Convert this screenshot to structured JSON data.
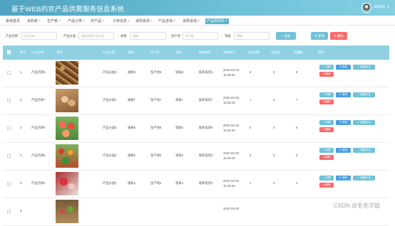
{
  "header": {
    "app_title": "基于WEB的农产品供需服务信息系统",
    "user_name": "admin",
    "user_caret": "▾"
  },
  "tabs": [
    {
      "label": "系统首页",
      "closable": false,
      "active": false
    },
    {
      "label": "采购者",
      "closable": true,
      "active": false
    },
    {
      "label": "生产者",
      "closable": true,
      "active": false
    },
    {
      "label": "产品分类",
      "closable": true,
      "active": false
    },
    {
      "label": "农产品",
      "closable": true,
      "active": false
    },
    {
      "label": "订单信息",
      "closable": true,
      "active": false
    },
    {
      "label": "采购需求",
      "closable": true,
      "active": false
    },
    {
      "label": "产品咨询",
      "closable": true,
      "active": false
    },
    {
      "label": "采购咨询",
      "closable": true,
      "active": false
    },
    {
      "label": "产品预评价",
      "closable": true,
      "active": true
    }
  ],
  "tab_close_glyph": "×",
  "search": {
    "fields": [
      {
        "label": "产品名称",
        "placeholder": "产品名称"
      },
      {
        "label": "产品分类",
        "placeholder": "请到选择产品分类"
      },
      {
        "label": "规格",
        "placeholder": "规格"
      },
      {
        "label": "生产地",
        "placeholder": "生产地"
      },
      {
        "label": "等级",
        "placeholder": "等级"
      }
    ],
    "search_button": "查询",
    "add_button": "新增",
    "delete_button": "删除"
  },
  "table": {
    "columns": [
      "序号",
      "产品名称",
      "图片",
      "产品分类",
      "规格",
      "生产地",
      "等级",
      "联系电话",
      "发布时间",
      "点击次数",
      "评论数",
      "收藏数",
      "操作"
    ],
    "rows": [
      {
        "index": "1",
        "name": "产品名称8",
        "category": "产品分类8",
        "spec": "规格8",
        "origin": "生产地8",
        "grade": "等级8",
        "phone": "联系电话8",
        "date": "2024-02-03",
        "time": "16:36:40",
        "clicks": "8",
        "comments": "0",
        "favorites": "8",
        "image": "pepper"
      },
      {
        "index": "2",
        "name": "产品名称7",
        "category": "产品分类7",
        "spec": "规格7",
        "origin": "生产地7",
        "grade": "等级7",
        "phone": "联系电话7",
        "date": "2024-02-03",
        "time": "16:36:40",
        "clicks": "7",
        "comments": "0",
        "favorites": "7",
        "image": "ginger"
      },
      {
        "index": "3",
        "name": "产品名称6",
        "category": "产品分类6",
        "spec": "规格6",
        "origin": "生产地6",
        "grade": "等级6",
        "phone": "联系电话6",
        "date": "2024-02-03",
        "time": "16:36:40",
        "clicks": "6",
        "comments": "0",
        "favorites": "6",
        "image": "peach"
      },
      {
        "index": "4",
        "name": "产品名称5",
        "category": "产品分类5",
        "spec": "规格5",
        "origin": "生产地5",
        "grade": "等级5",
        "phone": "联系电话5",
        "date": "2024-02-03",
        "time": "16:36:40",
        "clicks": "5",
        "comments": "0",
        "favorites": "5",
        "image": "vegetables"
      },
      {
        "index": "5",
        "name": "产品名称4",
        "category": "产品分类4",
        "spec": "规格4",
        "origin": "生产地4",
        "grade": "等级4",
        "phone": "联系电话4",
        "date": "2024-02-03",
        "time": "16:36:40",
        "clicks": "4",
        "comments": "0",
        "favorites": "4",
        "image": "fruit"
      },
      {
        "index": "6",
        "name": "",
        "category": "",
        "spec": "",
        "origin": "",
        "grade": "",
        "phone": "",
        "date": "2024-02-03",
        "time": "",
        "clicks": "",
        "comments": "",
        "favorites": "",
        "image": "mixed"
      }
    ],
    "actions": {
      "detail": "详情",
      "edit": "修改",
      "review": "查看评论",
      "delete": "删除"
    }
  },
  "watermark": "CSDN @毛毛学姐",
  "colors": {
    "header": "#5bb3cc",
    "table_head": "#8fd1e3",
    "accent": "#6fc1d8",
    "danger": "#f56c6c",
    "edit": "#4a9fe0"
  }
}
